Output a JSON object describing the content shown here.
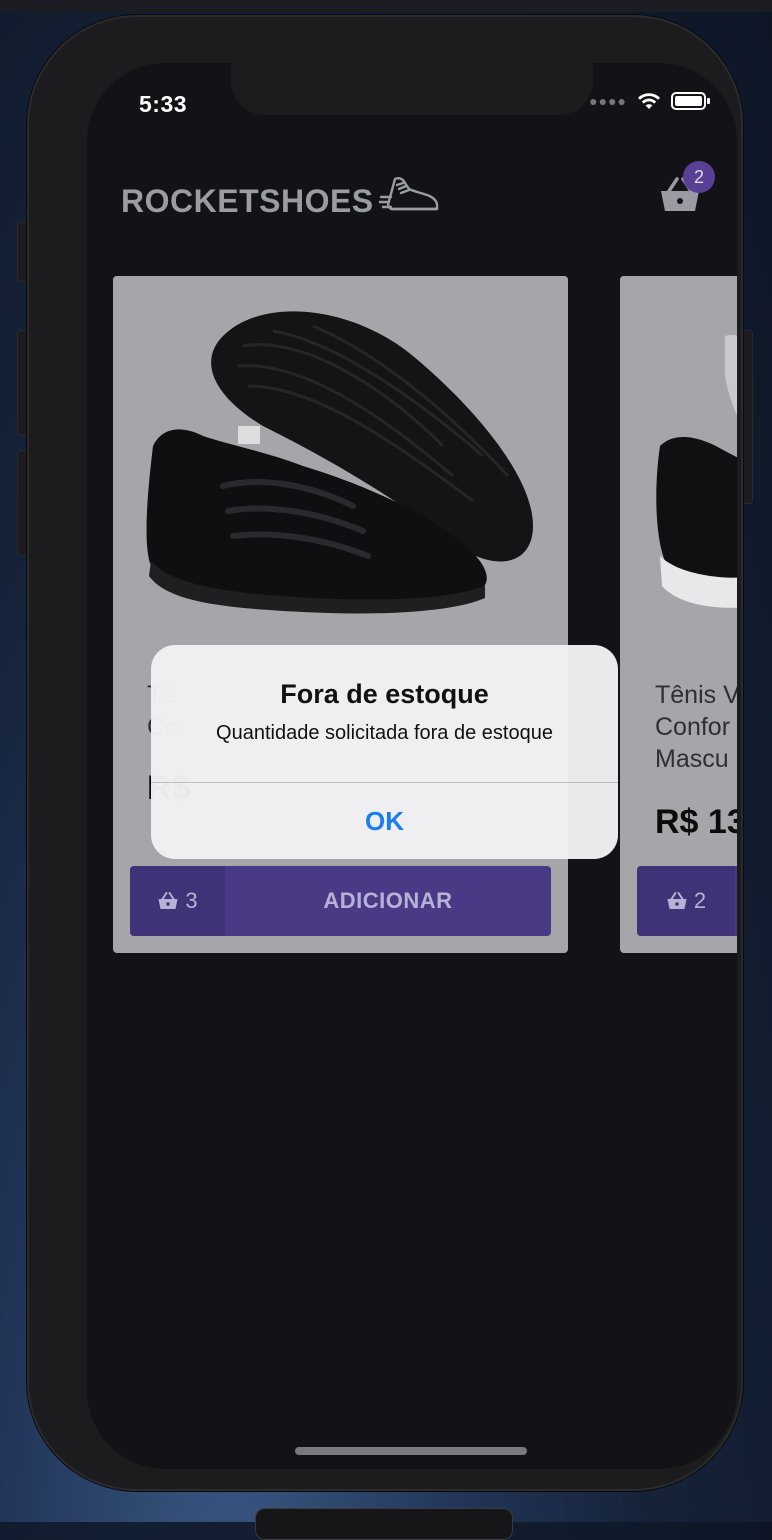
{
  "status_bar": {
    "time": "5:33"
  },
  "header": {
    "logo_text": "ROCKETSHOES",
    "logo_icon": "sneaker-icon",
    "cart_icon": "basket-icon",
    "cart_count": "2"
  },
  "products": [
    {
      "title_line1": "Tê",
      "title_line2": "Co",
      "price": "R$",
      "cart_qty": "3",
      "add_label": "ADICIONAR"
    },
    {
      "title_line1": "Tênis V",
      "title_line2": "Confor",
      "title_line3": "Mascu",
      "price": "R$ 13",
      "cart_qty": "2"
    }
  ],
  "alert": {
    "title": "Fora de estoque",
    "message": "Quantidade solicitada fora de estoque",
    "ok_label": "OK"
  },
  "colors": {
    "accent": "#5a3f96",
    "button": "#4a3a86",
    "alert_action": "#1a7ef0",
    "background": "#131217"
  }
}
